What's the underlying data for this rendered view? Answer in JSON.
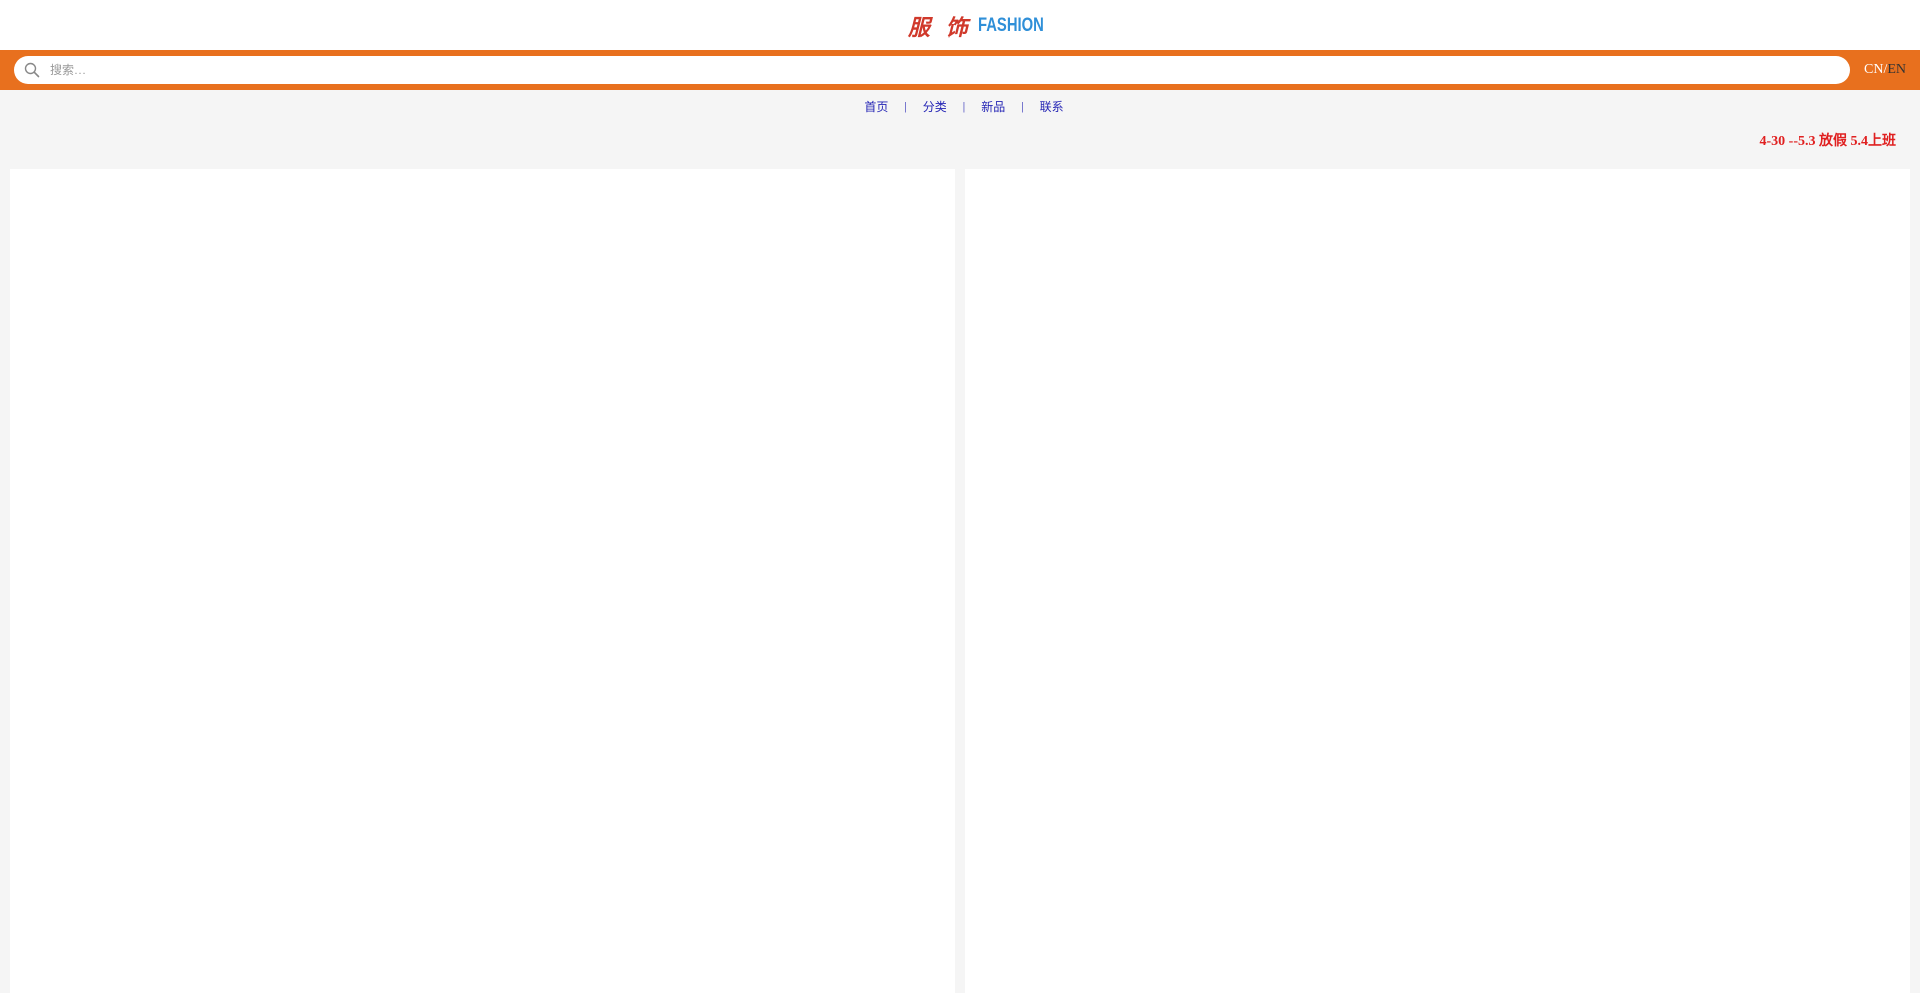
{
  "header": {
    "logo_cn": "服 饰",
    "logo_en": "FASHION"
  },
  "search": {
    "placeholder": "搜索…",
    "value": ""
  },
  "language": {
    "cn": "CN",
    "separator": "/",
    "en": "EN"
  },
  "nav": {
    "items": [
      {
        "label": "首页"
      },
      {
        "label": "分类"
      },
      {
        "label": "新品"
      },
      {
        "label": "联系"
      }
    ],
    "divider": "|"
  },
  "notice": {
    "text": "4-30 --5.3 放假  5.4上班"
  },
  "colors": {
    "search_bar": "#e8701e",
    "nav_link": "#2525b5",
    "notice": "#e02020",
    "logo_cn": "#d0392b",
    "logo_en": "#2f8fd8"
  }
}
